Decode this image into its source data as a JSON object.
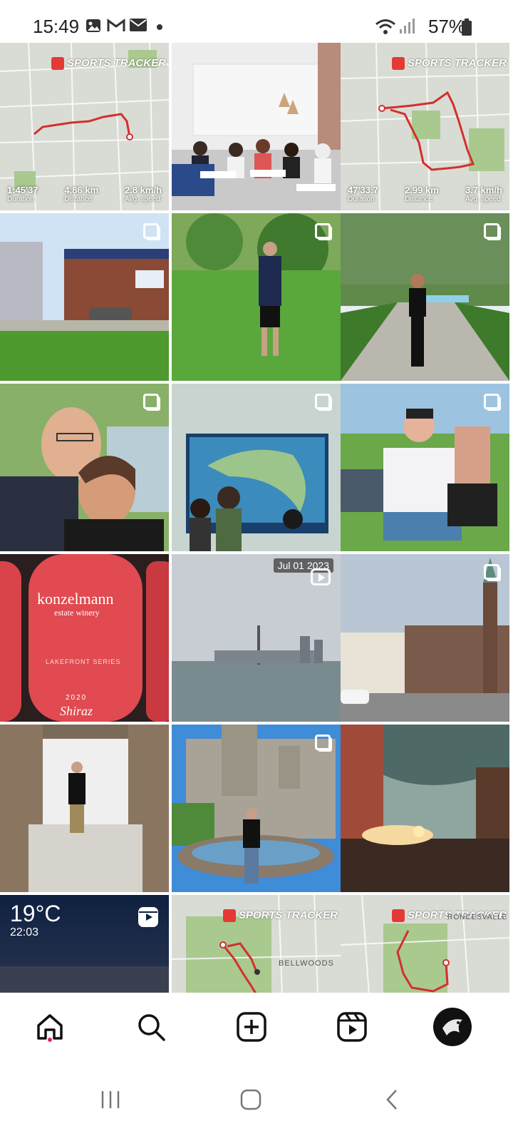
{
  "status": {
    "time": "15:49",
    "battery": "57%"
  },
  "tiles": [
    {
      "kind": "map",
      "logo": "SPORTS TRACKER",
      "stats": [
        {
          "v": "1:45'37",
          "l": "Duration"
        },
        {
          "v": "4.86 km",
          "l": "Distance"
        },
        {
          "v": "2.8 km/h",
          "l": "Avg. speed"
        }
      ]
    },
    {
      "kind": "photo",
      "desc": "office group"
    },
    {
      "kind": "map",
      "logo": "SPORTS TRACKER",
      "stats": [
        {
          "v": "47'33.7",
          "l": "Duration"
        },
        {
          "v": "2.99 km",
          "l": "Distance"
        },
        {
          "v": "3.7 km/h",
          "l": "Avg. speed"
        }
      ]
    },
    {
      "kind": "photo",
      "multi": true
    },
    {
      "kind": "photo",
      "multi": true
    },
    {
      "kind": "photo",
      "multi": true
    },
    {
      "kind": "photo",
      "multi": true
    },
    {
      "kind": "photo",
      "multi": true
    },
    {
      "kind": "photo",
      "multi": true
    },
    {
      "kind": "photo",
      "wine_brand": "konzelmann",
      "wine_sub": "estate winery",
      "wine_series": "LAKEFRONT SERIES",
      "wine_year": "2020",
      "wine_name": "Shiraz"
    },
    {
      "kind": "video",
      "date": "Jul 01 2023"
    },
    {
      "kind": "photo",
      "multi": true
    },
    {
      "kind": "photo"
    },
    {
      "kind": "photo",
      "multi": true
    },
    {
      "kind": "photo"
    },
    {
      "kind": "reel",
      "temp": "19°C",
      "time": "22:03"
    },
    {
      "kind": "map",
      "logo": "SPORTS TRACKER",
      "area": "BELLWOODS"
    },
    {
      "kind": "map",
      "logo": "SPORTS TRACKER",
      "area": "RONCESVALLE"
    }
  ],
  "nav": [
    "home-icon",
    "search-icon",
    "create-icon",
    "reels-icon",
    "profile-avatar"
  ],
  "colors": {
    "accent": "#e0245e",
    "map_route": "#d32f2f"
  }
}
